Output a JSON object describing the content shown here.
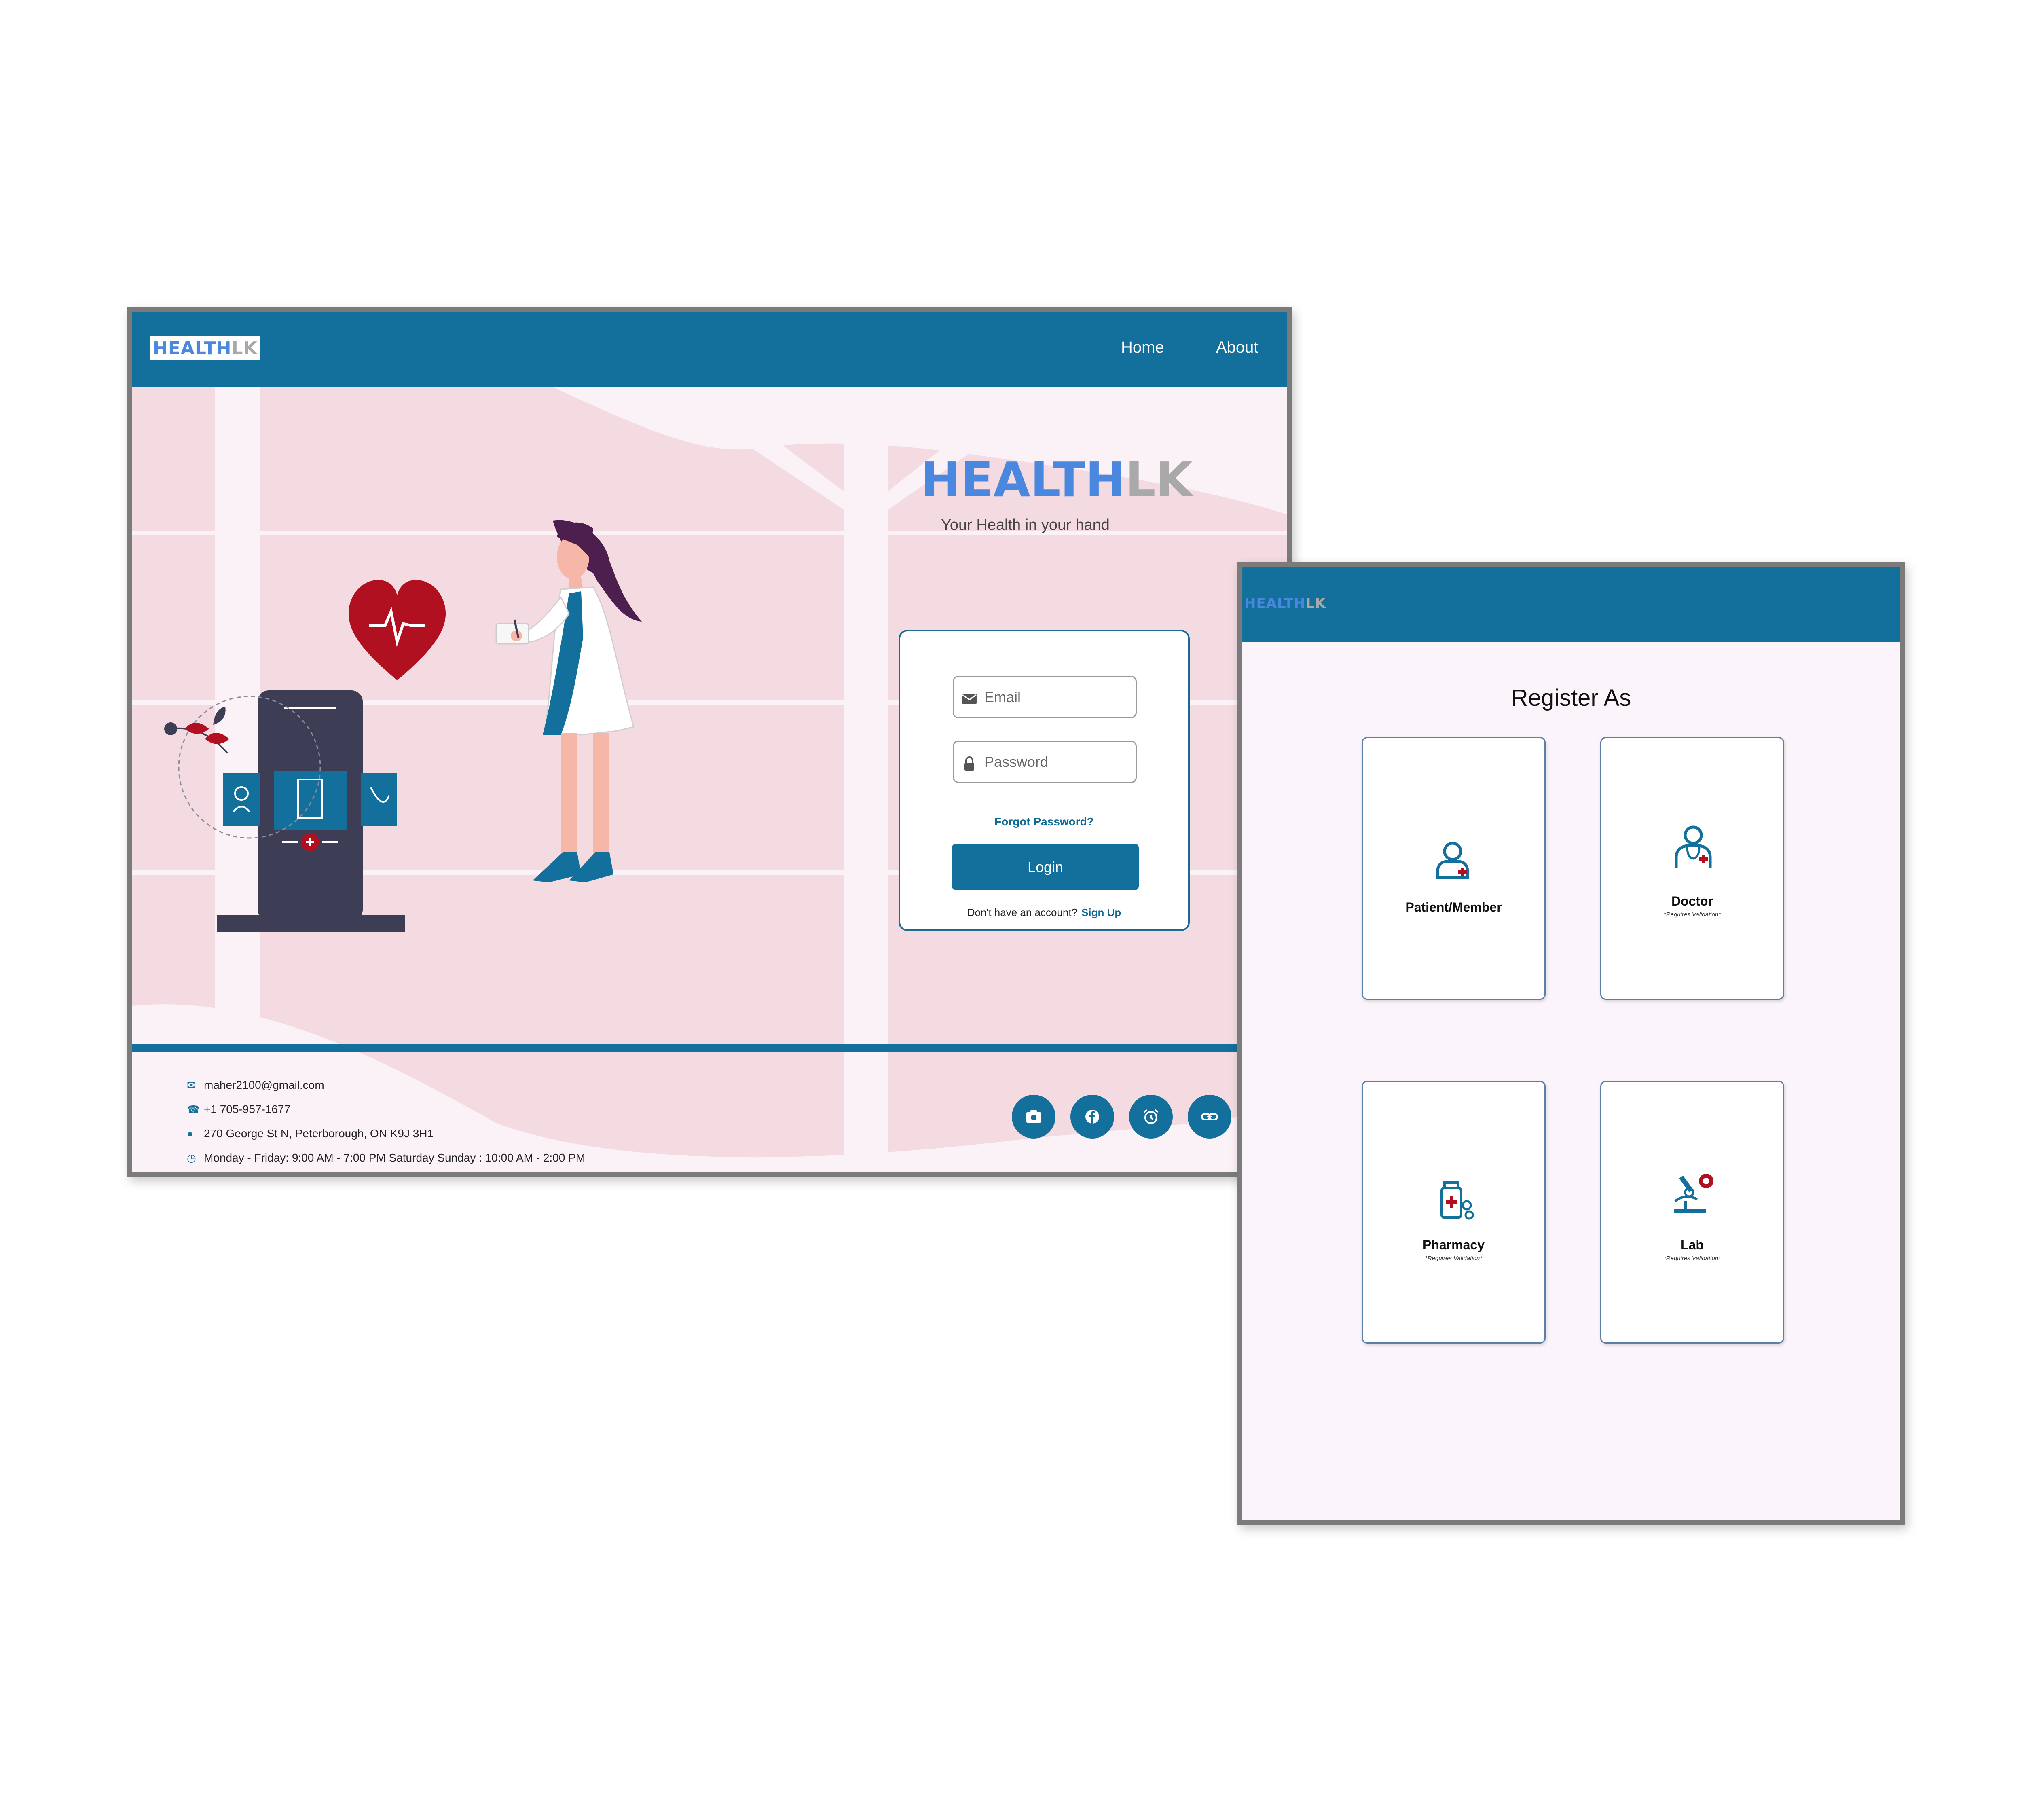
{
  "login_page": {
    "logo": {
      "part1": "HEALTH",
      "part2": "LK"
    },
    "nav": {
      "home": "Home",
      "about": "About"
    },
    "brand": {
      "part1": "HEALTH",
      "part2": "LK",
      "tagline": "Your Health in your hand"
    },
    "form": {
      "email_placeholder": "Email",
      "password_placeholder": "Password",
      "forgot_password": "Forgot Password?",
      "login_button": "Login",
      "no_account": "Don't have an account?",
      "sign_up": "Sign Up"
    },
    "footer": {
      "email": "maher2100@gmail.com",
      "phone": "+1 705-957-1677",
      "address": "270 George St N, Peterborough, ON K9J 3H1",
      "hours": "Monday - Friday: 9:00 AM - 7:00 PM Saturday Sunday : 10:00 AM - 2:00 PM"
    },
    "social_icons": [
      "camera-icon",
      "facebook-icon",
      "alarm-icon",
      "link-icon"
    ]
  },
  "register_page": {
    "logo": {
      "part1": "HEALTH",
      "part2": "LK"
    },
    "title": "Register As",
    "roles": [
      {
        "label": "Patient/Member",
        "note": ""
      },
      {
        "label": "Doctor",
        "note": "*Requires Validation*"
      },
      {
        "label": "Pharmacy",
        "note": "*Requires Validation*"
      },
      {
        "label": "Lab",
        "note": "*Requires Validation*"
      }
    ]
  },
  "colors": {
    "primary": "#136f9b",
    "logo_blue": "#4a88e0",
    "logo_gray": "#a9a9a9",
    "hero_pink": "#f4dbe2",
    "accent_red": "#b01020",
    "page_bg": "#fbf4fb"
  }
}
